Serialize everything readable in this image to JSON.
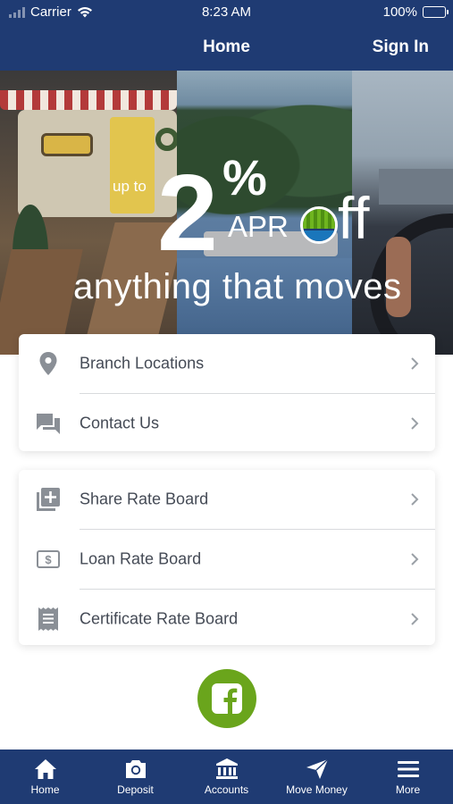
{
  "status_bar": {
    "carrier": "Carrier",
    "time": "8:23 AM",
    "battery": "100%",
    "battery_level": 1.0
  },
  "nav": {
    "title": "Home",
    "sign_in": "Sign In"
  },
  "banner": {
    "up_to": "up to",
    "big_number": "2",
    "percent": "%",
    "apr": "APR",
    "off_suffix": "ff",
    "tagline": "anything that moves"
  },
  "menu_group_1": [
    {
      "label": "Branch Locations",
      "icon": "location-pin-icon"
    },
    {
      "label": "Contact Us",
      "icon": "chat-bubbles-icon"
    }
  ],
  "menu_group_2": [
    {
      "label": "Share Rate Board",
      "icon": "add-to-list-icon"
    },
    {
      "label": "Loan Rate Board",
      "icon": "dollar-card-icon"
    },
    {
      "label": "Certificate Rate Board",
      "icon": "receipt-icon"
    }
  ],
  "social": {
    "icon": "facebook-icon",
    "color": "#6aa51c"
  },
  "tabs": [
    {
      "label": "Home",
      "icon": "home-icon"
    },
    {
      "label": "Deposit",
      "icon": "camera-icon"
    },
    {
      "label": "Accounts",
      "icon": "bank-icon"
    },
    {
      "label": "Move Money",
      "icon": "paper-plane-icon"
    },
    {
      "label": "More",
      "icon": "menu-icon"
    }
  ],
  "colors": {
    "brand_navy": "#1f3b73",
    "brand_green": "#6aa51c",
    "text_gray": "#444a55",
    "icon_gray": "#8a8f96"
  }
}
